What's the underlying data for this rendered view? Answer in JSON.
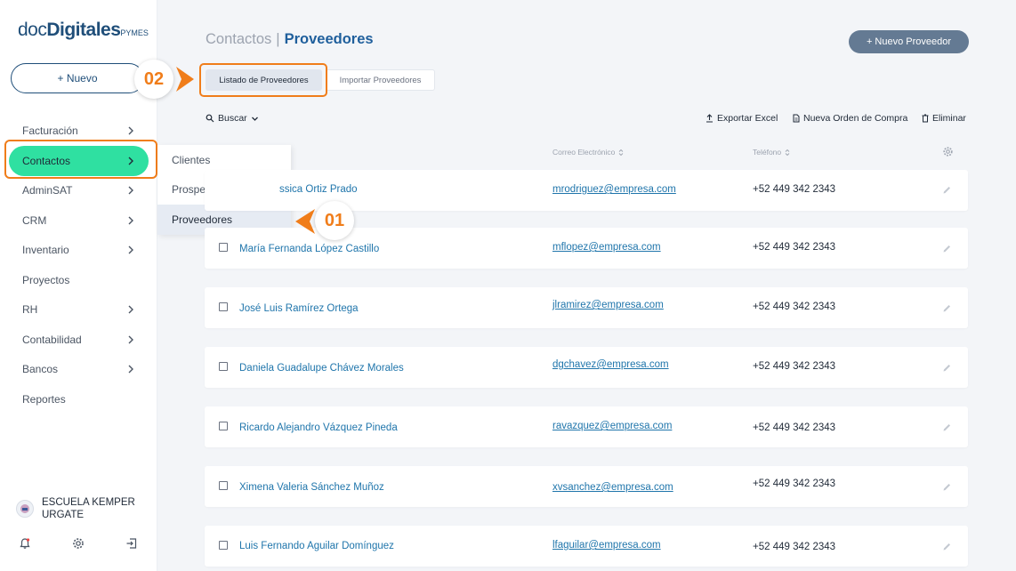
{
  "logo": {
    "part1": "doc",
    "part2": "Digitales",
    "part3": "PYMES"
  },
  "sidebar": {
    "new_label": "+ Nuevo",
    "items": [
      {
        "label": "Facturación",
        "chevron": true
      },
      {
        "label": "Contactos",
        "chevron": true,
        "active": true
      },
      {
        "label": "AdminSAT",
        "chevron": true
      },
      {
        "label": "CRM",
        "chevron": true
      },
      {
        "label": "Inventario",
        "chevron": true
      },
      {
        "label": "Proyectos",
        "chevron": false
      },
      {
        "label": "RH",
        "chevron": true
      },
      {
        "label": "Contabilidad",
        "chevron": true
      },
      {
        "label": "Bancos",
        "chevron": true
      },
      {
        "label": "Reportes",
        "chevron": false
      }
    ],
    "user_name": "ESCUELA KEMPER URGATE"
  },
  "submenu": {
    "items": [
      "Clientes",
      "Prospectos",
      "Proveedores"
    ],
    "selected": "Proveedores"
  },
  "header": {
    "crumb1": "Contactos",
    "sep": "|",
    "crumb2": "Proveedores",
    "new_button": "+ Nuevo Proveedor"
  },
  "tabs": [
    "Listado de Proveedores",
    "Importar Proveedores"
  ],
  "toolbar": {
    "search": "Buscar",
    "export": "Exportar Excel",
    "order": "Nueva Orden de Compra",
    "delete": "Eliminar"
  },
  "table": {
    "columns": {
      "email": "Correo Electrónico",
      "phone": "Teléfono"
    },
    "rows": [
      {
        "name": "Jessica Ortiz Prado",
        "visible_name": "ssica Ortiz Prado",
        "email": "mrodriguez@empresa.com",
        "phone": "+52 449 342 2343"
      },
      {
        "name": "María Fernanda López Castillo",
        "email": "mflopez@empresa.com",
        "phone": "+52 449 342 2343"
      },
      {
        "name": "José Luis Ramírez Ortega",
        "email": "jlramirez@empresa.com",
        "phone": "+52 449 342 2343"
      },
      {
        "name": "Daniela Guadalupe Chávez Morales",
        "email": "dgchavez@empresa.com",
        "phone": "+52 449 342 2343"
      },
      {
        "name": "Ricardo Alejandro Vázquez Pineda",
        "email": "ravazquez@empresa.com",
        "phone": "+52 449 342 2343"
      },
      {
        "name": "Ximena Valeria Sánchez Muñoz",
        "email": "xvsanchez@empresa.com",
        "phone": "+52 449 342 2343"
      },
      {
        "name": "Luis Fernando Aguilar Domínguez",
        "email": "lfaguilar@empresa.com",
        "phone": "+52 449 342 2343"
      }
    ]
  },
  "callouts": {
    "step1": "01",
    "step2": "02"
  },
  "colors": {
    "accent": "#2fe0a1",
    "highlight": "#f07d1a",
    "primary": "#1f4e79",
    "link": "#1f75ab"
  }
}
